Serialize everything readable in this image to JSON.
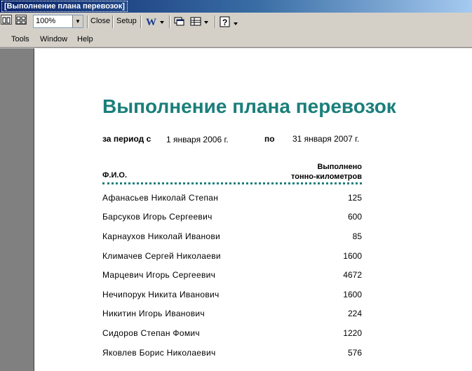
{
  "window": {
    "title": "[Выполнение плана перевозок]"
  },
  "toolbar": {
    "zoom": "100%",
    "close_label": "Close",
    "setup_label": "Setup"
  },
  "menu": {
    "tools": "Tools",
    "window": "Window",
    "help": "Help"
  },
  "report": {
    "title": "Выполнение плана перевозок",
    "period_label": "за период с",
    "period_from": "1 января 2006 г.",
    "period_to_label": "по",
    "period_to": "31 января 2007 г.",
    "col_fio": "Ф.И.О.",
    "col_done_line1": "Выполнено",
    "col_done_line2": "тонно-километров",
    "rows": [
      {
        "name": "Афанасьев Николай Степан",
        "value": "125"
      },
      {
        "name": "Барсуков Игорь Сергеевич",
        "value": "600"
      },
      {
        "name": "Карнаухов Николай Иванови",
        "value": "85"
      },
      {
        "name": "Климачев Сергей Николаеви",
        "value": "1600"
      },
      {
        "name": "Марцевич Игорь Сергеевич",
        "value": "4672"
      },
      {
        "name": "Нечипорук Никита Иванович",
        "value": "1600"
      },
      {
        "name": "Никитин Игорь Иванович",
        "value": "224"
      },
      {
        "name": "Сидоров Степан Фомич",
        "value": "1220"
      },
      {
        "name": "Яковлев Борис Николаевич",
        "value": "576"
      }
    ]
  }
}
